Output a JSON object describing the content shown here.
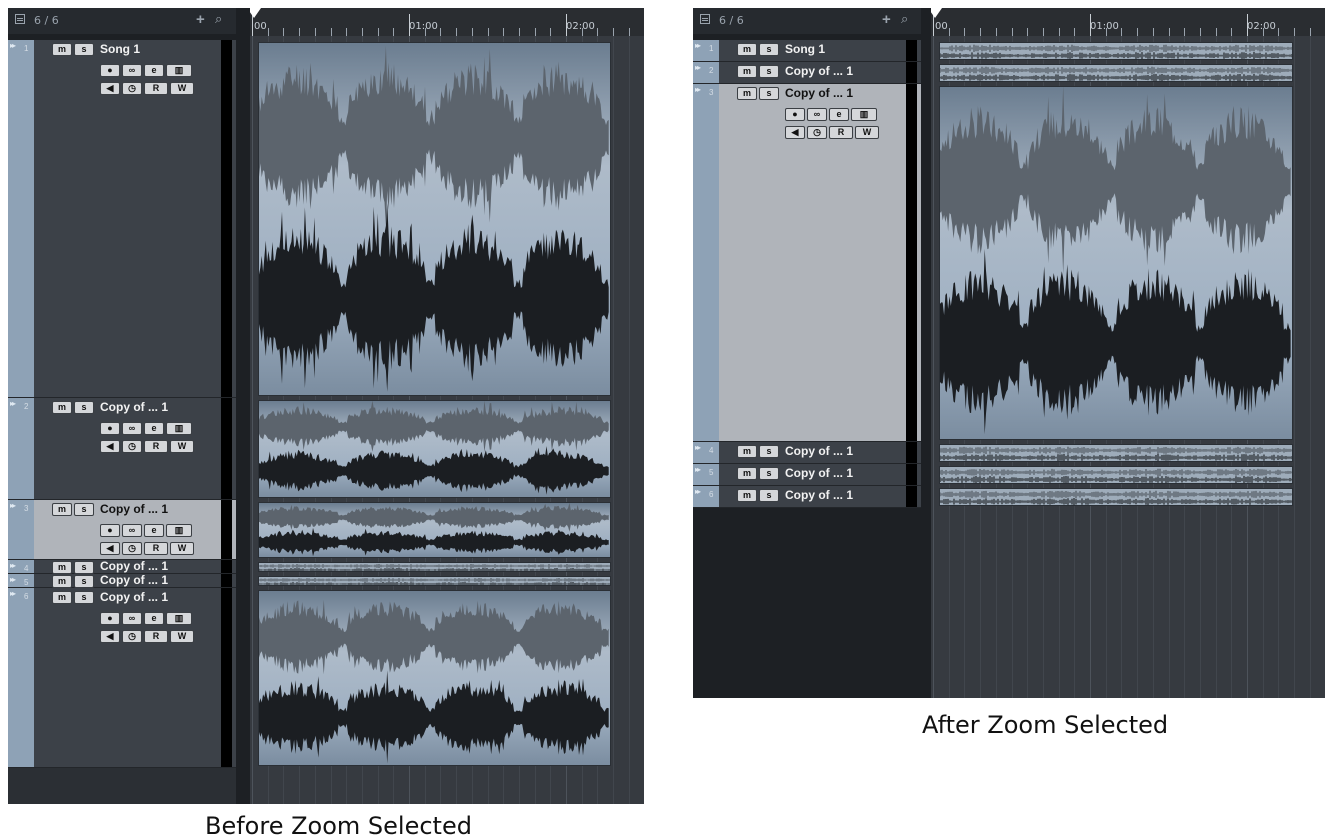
{
  "track_count": "6 / 6",
  "header_icons": {
    "list": "track-list-icon",
    "add": "+",
    "search": "⌕"
  },
  "ruler": {
    "t0": "00",
    "t1": "01:00",
    "t2": "02:00"
  },
  "buttons": {
    "mute": "m",
    "solo": "s",
    "record": "●",
    "link": "∞",
    "edit": "e",
    "lanes": "▥",
    "speaker": "◀",
    "clock": "◷",
    "read": "R",
    "write": "W"
  },
  "panels": [
    {
      "caption": "Before Zoom Selected",
      "tracks": [
        {
          "num": "1",
          "name": "Song 1"
        },
        {
          "num": "2",
          "name": "Copy of ... 1"
        },
        {
          "num": "3",
          "name": "Copy of ... 1",
          "selected": true
        },
        {
          "num": "4",
          "name": "Copy of ... 1"
        },
        {
          "num": "5",
          "name": "Copy of ... 1"
        },
        {
          "num": "6",
          "name": "Copy of ... 1"
        }
      ]
    },
    {
      "caption": "After Zoom Selected",
      "tracks": [
        {
          "num": "1",
          "name": "Song 1"
        },
        {
          "num": "2",
          "name": "Copy of ... 1"
        },
        {
          "num": "3",
          "name": "Copy of ... 1",
          "selected": true
        },
        {
          "num": "4",
          "name": "Copy of ... 1"
        },
        {
          "num": "5",
          "name": "Copy of ... 1"
        },
        {
          "num": "6",
          "name": "Copy of ... 1"
        }
      ]
    }
  ],
  "colors": {
    "clip_top": "#6b7d90",
    "clip_mid": "#aebbc9",
    "wave_upper": "#5c646d",
    "wave_lower": "#1b1e22",
    "strip": "#8ea2b6",
    "selected_track": "#b0b4ba"
  }
}
